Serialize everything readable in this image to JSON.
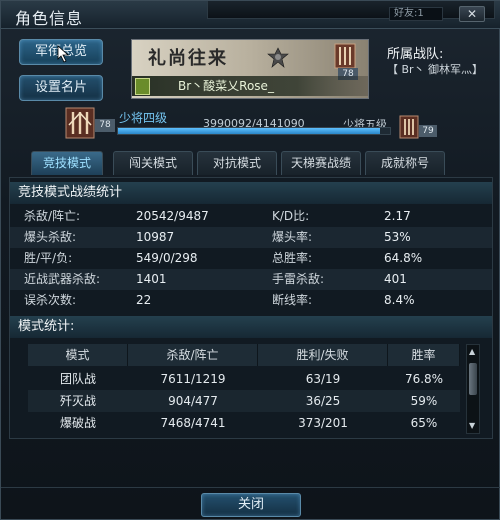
{
  "window": {
    "title": "角色信息",
    "friends": "好友:1",
    "close_glyph": "✕"
  },
  "sidebar": {
    "items": [
      {
        "label": "军衔总览"
      },
      {
        "label": "设置名片"
      }
    ]
  },
  "card": {
    "title": "礼尚往来",
    "player_name": "Br丶酸菜乂Rose_",
    "rank_level": "78"
  },
  "team": {
    "label": "所属战队:",
    "name": "【 Br丶 御林军灬】"
  },
  "rank": {
    "current_level": "78",
    "current_name": "少将四级",
    "exp_text": "3990092/4141090",
    "progress": 0.963,
    "next_name": "少将五级",
    "next_level": "79"
  },
  "tabs": [
    {
      "label": "竞技模式",
      "active": true
    },
    {
      "label": "闯关模式"
    },
    {
      "label": "对抗模式"
    },
    {
      "label": "天梯赛战绩"
    },
    {
      "label": "成就称号"
    }
  ],
  "stats": {
    "title": "竞技模式战绩统计",
    "rows": [
      {
        "l1": "杀敌/阵亡:",
        "v1": "20542/9487",
        "l2": "K/D比:",
        "v2": "2.17"
      },
      {
        "l1": "爆头杀敌:",
        "v1": "10987",
        "l2": "爆头率:",
        "v2": "53%"
      },
      {
        "l1": "胜/平/负:",
        "v1": "549/0/298",
        "l2": "总胜率:",
        "v2": "64.8%"
      },
      {
        "l1": "近战武器杀敌:",
        "v1": "1401",
        "l2": "手雷杀敌:",
        "v2": "401"
      },
      {
        "l1": "误杀次数:",
        "v1": "22",
        "l2": "断线率:",
        "v2": "8.4%"
      }
    ]
  },
  "modes": {
    "title": "模式统计:",
    "headers": [
      "模式",
      "杀敌/阵亡",
      "胜利/失败",
      "胜率"
    ],
    "rows": [
      [
        "团队战",
        "7611/1219",
        "63/19",
        "76.8%"
      ],
      [
        "歼灭战",
        "904/477",
        "36/25",
        "59%"
      ],
      [
        "爆破战",
        "7468/4741",
        "373/201",
        "65%"
      ]
    ]
  },
  "footer": {
    "close_label": "关闭"
  },
  "colors": {
    "accent": "#74c4f0",
    "button": "#24506e"
  }
}
